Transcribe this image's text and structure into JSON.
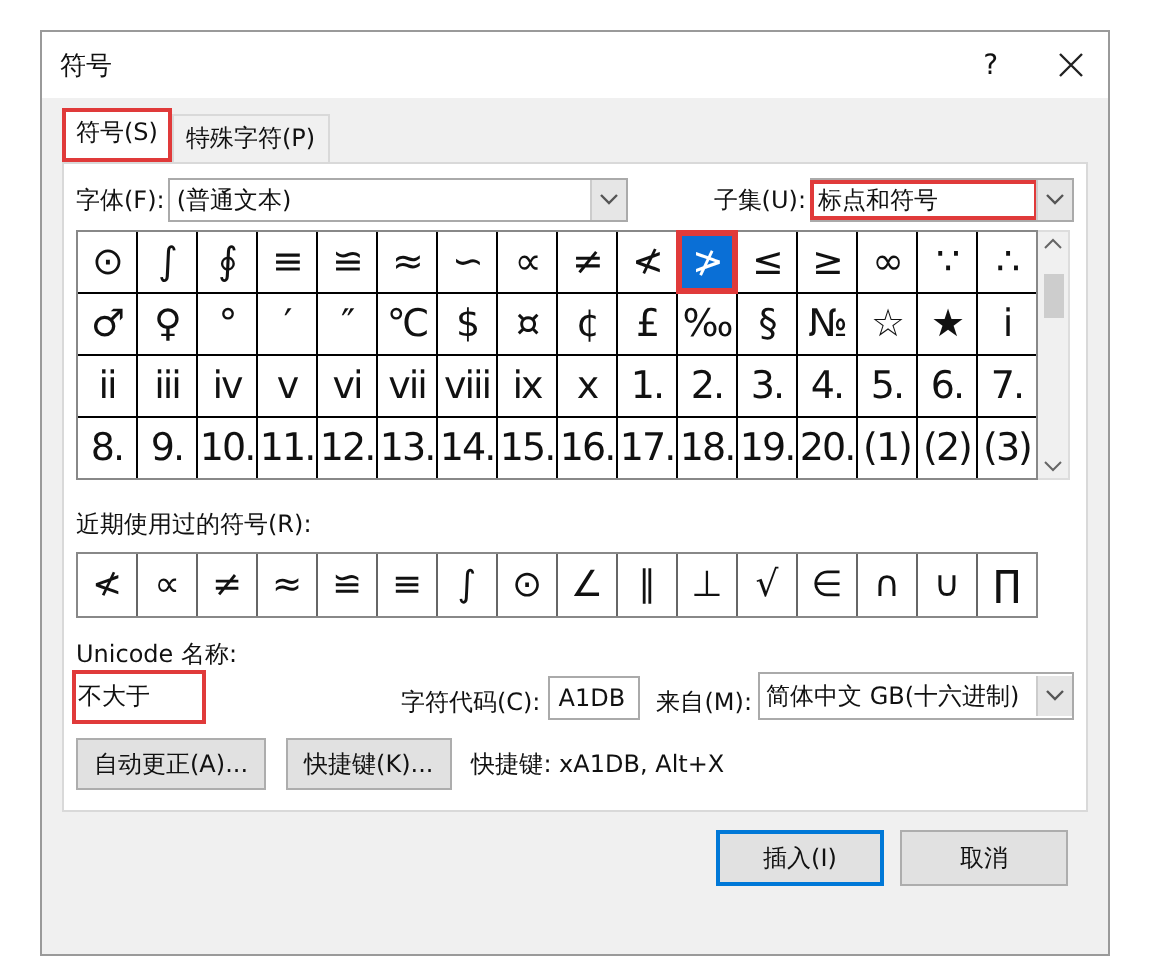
{
  "window": {
    "title": "符号",
    "help": "?"
  },
  "tabs": [
    {
      "label": "符号(S)",
      "selected": true,
      "annotated": true
    },
    {
      "label": "特殊字符(P)",
      "selected": false,
      "annotated": false
    }
  ],
  "font_field": {
    "label": "字体(F):",
    "value": "(普通文本)"
  },
  "subset_field": {
    "label": "子集(U):",
    "value": "标点和符号",
    "annotated": true
  },
  "symbol_grid": {
    "selection_annotated": true,
    "rows": [
      [
        {
          "c": "⊙",
          "selected": false
        },
        {
          "c": "∫",
          "selected": false
        },
        {
          "c": "∮",
          "selected": false
        },
        {
          "c": "≡",
          "selected": false
        },
        {
          "c": "≌",
          "selected": false
        },
        {
          "c": "≈",
          "selected": false
        },
        {
          "c": "∽",
          "selected": false
        },
        {
          "c": "∝",
          "selected": false
        },
        {
          "c": "≠",
          "selected": false
        },
        {
          "c": "≮",
          "selected": false
        },
        {
          "c": "≯",
          "selected": true
        },
        {
          "c": "≤",
          "selected": false
        },
        {
          "c": "≥",
          "selected": false
        },
        {
          "c": "∞",
          "selected": false
        },
        {
          "c": "∵",
          "selected": false
        },
        {
          "c": "∴",
          "selected": false
        }
      ],
      [
        {
          "c": "♂",
          "selected": false
        },
        {
          "c": "♀",
          "selected": false
        },
        {
          "c": "°",
          "selected": false
        },
        {
          "c": "′",
          "selected": false
        },
        {
          "c": "″",
          "selected": false
        },
        {
          "c": "℃",
          "selected": false
        },
        {
          "c": "$",
          "selected": false
        },
        {
          "c": "¤",
          "selected": false
        },
        {
          "c": "¢",
          "selected": false
        },
        {
          "c": "£",
          "selected": false
        },
        {
          "c": "‰",
          "selected": false
        },
        {
          "c": "§",
          "selected": false
        },
        {
          "c": "№",
          "selected": false
        },
        {
          "c": "☆",
          "selected": false
        },
        {
          "c": "★",
          "selected": false
        },
        {
          "c": "i",
          "selected": false
        }
      ],
      [
        {
          "c": "ii",
          "selected": false
        },
        {
          "c": "iii",
          "selected": false
        },
        {
          "c": "iv",
          "selected": false
        },
        {
          "c": "v",
          "selected": false
        },
        {
          "c": "vi",
          "selected": false
        },
        {
          "c": "vii",
          "selected": false
        },
        {
          "c": "viii",
          "selected": false
        },
        {
          "c": "ix",
          "selected": false
        },
        {
          "c": "x",
          "selected": false
        },
        {
          "c": "1.",
          "selected": false
        },
        {
          "c": "2.",
          "selected": false
        },
        {
          "c": "3.",
          "selected": false
        },
        {
          "c": "4.",
          "selected": false
        },
        {
          "c": "5.",
          "selected": false
        },
        {
          "c": "6.",
          "selected": false
        },
        {
          "c": "7.",
          "selected": false
        }
      ],
      [
        {
          "c": "8.",
          "selected": false
        },
        {
          "c": "9.",
          "selected": false
        },
        {
          "c": "10.",
          "selected": false
        },
        {
          "c": "11.",
          "selected": false
        },
        {
          "c": "12.",
          "selected": false
        },
        {
          "c": "13.",
          "selected": false
        },
        {
          "c": "14.",
          "selected": false
        },
        {
          "c": "15.",
          "selected": false
        },
        {
          "c": "16.",
          "selected": false
        },
        {
          "c": "17.",
          "selected": false
        },
        {
          "c": "18.",
          "selected": false
        },
        {
          "c": "19.",
          "selected": false
        },
        {
          "c": "20.",
          "selected": false
        },
        {
          "c": "(1)",
          "selected": false
        },
        {
          "c": "(2)",
          "selected": false
        },
        {
          "c": "(3)",
          "selected": false
        }
      ]
    ]
  },
  "recent": {
    "label": "近期使用过的符号(R):",
    "symbols": [
      "≮",
      "∝",
      "≠",
      "≈",
      "≌",
      "≡",
      "∫",
      "⊙",
      "∠",
      "∥",
      "⊥",
      "√",
      "∈",
      "∩",
      "∪",
      "∏"
    ]
  },
  "unicode_name": {
    "label": "Unicode 名称:",
    "value": "不大于",
    "annotated": true
  },
  "char_code": {
    "label": "字符代码(C):",
    "value": "A1DB"
  },
  "from_field": {
    "label": "来自(M):",
    "value": "简体中文 GB(十六进制)"
  },
  "tool_buttons": [
    "自动更正(A)...",
    "快捷键(K)..."
  ],
  "shortcut_text": "快捷键: xA1DB, Alt+X",
  "footer_buttons": [
    {
      "label": "插入(I)",
      "default": true
    },
    {
      "label": "取消",
      "default": false
    }
  ]
}
